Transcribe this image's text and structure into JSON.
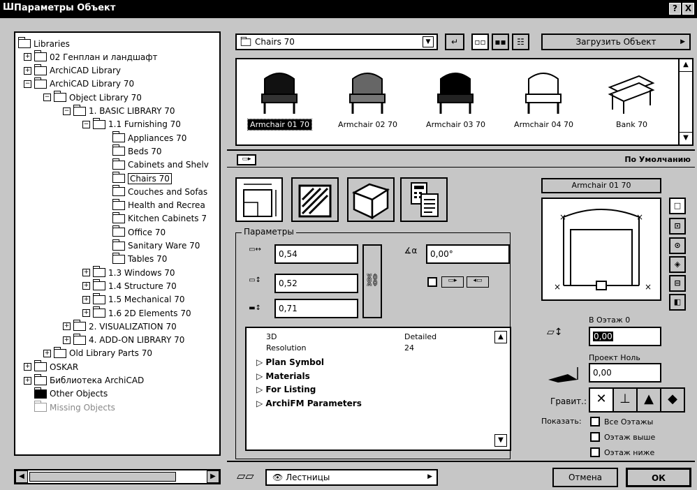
{
  "window": {
    "title": "Параметры Объект",
    "help": "?",
    "close": "X"
  },
  "tree": {
    "items": [
      {
        "label": "Libraries",
        "depth": 0,
        "exp": "",
        "icon": "folder"
      },
      {
        "label": "02 Генплан и ландшафт",
        "depth": 1,
        "exp": "+",
        "icon": "folder"
      },
      {
        "label": "ArchiCAD Library",
        "depth": 1,
        "exp": "+",
        "icon": "folder"
      },
      {
        "label": "ArchiCAD Library 70",
        "depth": 1,
        "exp": "-",
        "icon": "folder"
      },
      {
        "label": "Object Library 70",
        "depth": 2,
        "exp": "-",
        "icon": "folder"
      },
      {
        "label": "1. BASIC LIBRARY 70",
        "depth": 3,
        "exp": "-",
        "icon": "folder"
      },
      {
        "label": "1.1 Furnishing 70",
        "depth": 4,
        "exp": "-",
        "icon": "folder"
      },
      {
        "label": "Appliances 70",
        "depth": 5,
        "exp": "",
        "icon": "folder"
      },
      {
        "label": "Beds 70",
        "depth": 5,
        "exp": "",
        "icon": "folder"
      },
      {
        "label": "Cabinets and Shelv",
        "depth": 5,
        "exp": "",
        "icon": "folder"
      },
      {
        "label": "Chairs 70",
        "depth": 5,
        "exp": "",
        "icon": "folder",
        "selected": true
      },
      {
        "label": "Couches and Sofas",
        "depth": 5,
        "exp": "",
        "icon": "folder"
      },
      {
        "label": "Health and Recrea",
        "depth": 5,
        "exp": "",
        "icon": "folder"
      },
      {
        "label": "Kitchen Cabinets 7",
        "depth": 5,
        "exp": "",
        "icon": "folder"
      },
      {
        "label": "Office 70",
        "depth": 5,
        "exp": "",
        "icon": "folder"
      },
      {
        "label": "Sanitary Ware 70",
        "depth": 5,
        "exp": "",
        "icon": "folder"
      },
      {
        "label": "Tables 70",
        "depth": 5,
        "exp": "",
        "icon": "folder"
      },
      {
        "label": "1.3 Windows 70",
        "depth": 4,
        "exp": "+",
        "icon": "folder"
      },
      {
        "label": "1.4 Structure 70",
        "depth": 4,
        "exp": "+",
        "icon": "folder"
      },
      {
        "label": "1.5 Mechanical 70",
        "depth": 4,
        "exp": "+",
        "icon": "folder"
      },
      {
        "label": "1.6 2D Elements 70",
        "depth": 4,
        "exp": "+",
        "icon": "folder"
      },
      {
        "label": "2. VISUALIZATION 70",
        "depth": 3,
        "exp": "+",
        "icon": "folder"
      },
      {
        "label": "4. ADD-ON LIBRARY 70",
        "depth": 3,
        "exp": "+",
        "icon": "folder"
      },
      {
        "label": "Old Library Parts 70",
        "depth": 2,
        "exp": "+",
        "icon": "folder"
      },
      {
        "label": "OSKAR",
        "depth": 0,
        "exp": "+",
        "icon": "folder",
        "pm0": true
      },
      {
        "label": "Библиотека ArchiCAD",
        "depth": 0,
        "exp": "+",
        "icon": "folder",
        "pm0": true
      },
      {
        "label": "Other Objects",
        "depth": 1,
        "exp": "",
        "icon": "dark"
      },
      {
        "label": "Missing Objects",
        "depth": 1,
        "exp": "",
        "icon": "grey",
        "grey": true
      }
    ]
  },
  "top": {
    "folder": "Chairs 70",
    "load": "Загрузить Объект",
    "arrow": "▶"
  },
  "thumbs": [
    {
      "label": "Armchair 01 70",
      "selected": true
    },
    {
      "label": "Armchair 02 70"
    },
    {
      "label": "Armchair 03 70"
    },
    {
      "label": "Armchair 04 70"
    },
    {
      "label": "Bank 70"
    }
  ],
  "bar": {
    "default": "По Умолчанию"
  },
  "params": {
    "group": "Параметры",
    "a": "0,54",
    "b": "0,52",
    "h": "0,71",
    "angle": "0,00°"
  },
  "list": {
    "rows": [
      {
        "k": "3D",
        "v": "Detailed"
      },
      {
        "k": "Resolution",
        "v": "24"
      }
    ],
    "sections": [
      "Plan Symbol",
      "Materials",
      "For Listing",
      "ArchiFM Parameters"
    ]
  },
  "preview": {
    "name": "Armchair 01 70"
  },
  "elev": {
    "story_label": "В Оэтаж 0",
    "story_value": "0,00",
    "proj_label": "Проект Ноль",
    "proj_value": "0,00"
  },
  "grav": {
    "label": "Гравит.:"
  },
  "show": {
    "label": "Показать:",
    "opts": [
      "Все Оэтажы",
      "Оэтаж выше",
      "Оэтаж ниже"
    ]
  },
  "bottom": {
    "layer": "Лестницы",
    "cancel": "Отмена",
    "ok": "ОК"
  }
}
